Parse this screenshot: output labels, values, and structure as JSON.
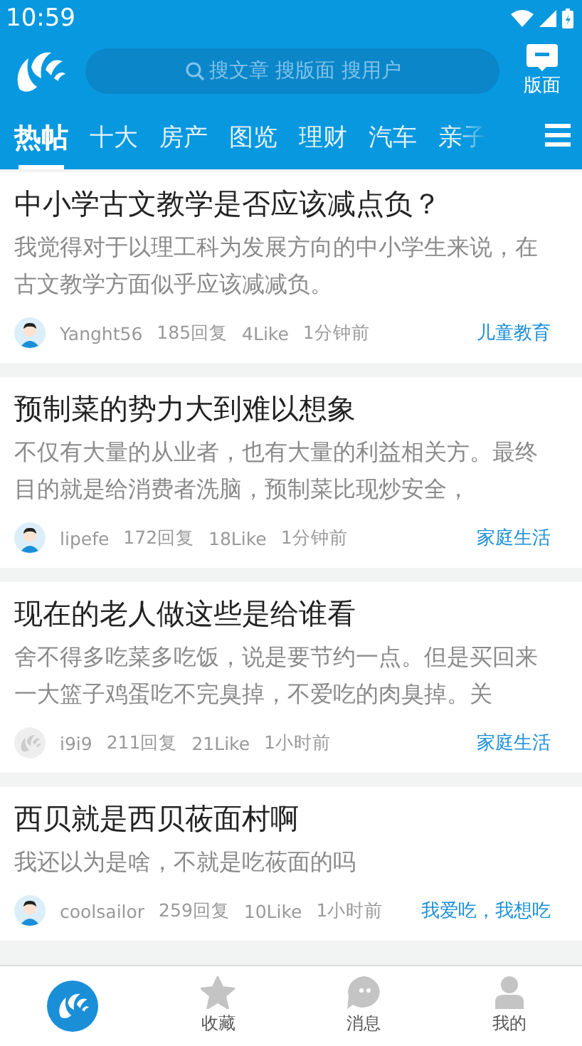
{
  "status_bar": {
    "time": "10:59"
  },
  "header": {
    "search": {
      "placeholder": "搜文章 搜版面 搜用户"
    },
    "board_button": "版面"
  },
  "tabs": [
    {
      "label": "热帖",
      "selected": true
    },
    {
      "label": "十大",
      "selected": false
    },
    {
      "label": "房产",
      "selected": false
    },
    {
      "label": "图览",
      "selected": false
    },
    {
      "label": "理财",
      "selected": false
    },
    {
      "label": "汽车",
      "selected": false
    },
    {
      "label": "亲子",
      "selected": false
    }
  ],
  "posts": [
    {
      "title": "中小学古文教学是否应该减点负？",
      "excerpt": "我觉得对于以理工科为发展方向的中小学生来说，在古文教学方面似乎应该减减负。",
      "avatar": {
        "kind": "person"
      },
      "author": "Yanght56",
      "replies": "185回复",
      "likes": "4Like",
      "time": "1分钟前",
      "board": "儿童教育"
    },
    {
      "title": "预制菜的势力大到难以想象",
      "excerpt": "不仅有大量的从业者，也有大量的利益相关方。最终目的就是给消费者洗脑，预制菜比现炒安全，",
      "avatar": {
        "kind": "person"
      },
      "author": "lipefe",
      "replies": "172回复",
      "likes": "18Like",
      "time": "1分钟前",
      "board": "家庭生活"
    },
    {
      "title": "现在的老人做这些是给谁看",
      "excerpt": "舍不得多吃菜多吃饭，说是要节约一点。但是买回来一大篮子鸡蛋吃不完臭掉，不爱吃的肉臭掉。关",
      "avatar": {
        "kind": "logo"
      },
      "author": "i9i9",
      "replies": "211回复",
      "likes": "21Like",
      "time": "1小时前",
      "board": "家庭生活"
    },
    {
      "title": "西贝就是西贝莜面村啊",
      "excerpt": "我还以为是啥，不就是吃莜面的吗",
      "avatar": {
        "kind": "person"
      },
      "author": "coolsailor",
      "replies": "259回复",
      "likes": "10Like",
      "time": "1小时前",
      "board": "我爱吃，我想吃"
    }
  ],
  "bottom_nav": [
    {
      "kind": "home",
      "selected": true
    },
    {
      "kind": "star",
      "label": "收藏",
      "selected": false
    },
    {
      "kind": "chat",
      "label": "消息",
      "selected": false
    },
    {
      "kind": "person",
      "label": "我的",
      "selected": false
    }
  ]
}
